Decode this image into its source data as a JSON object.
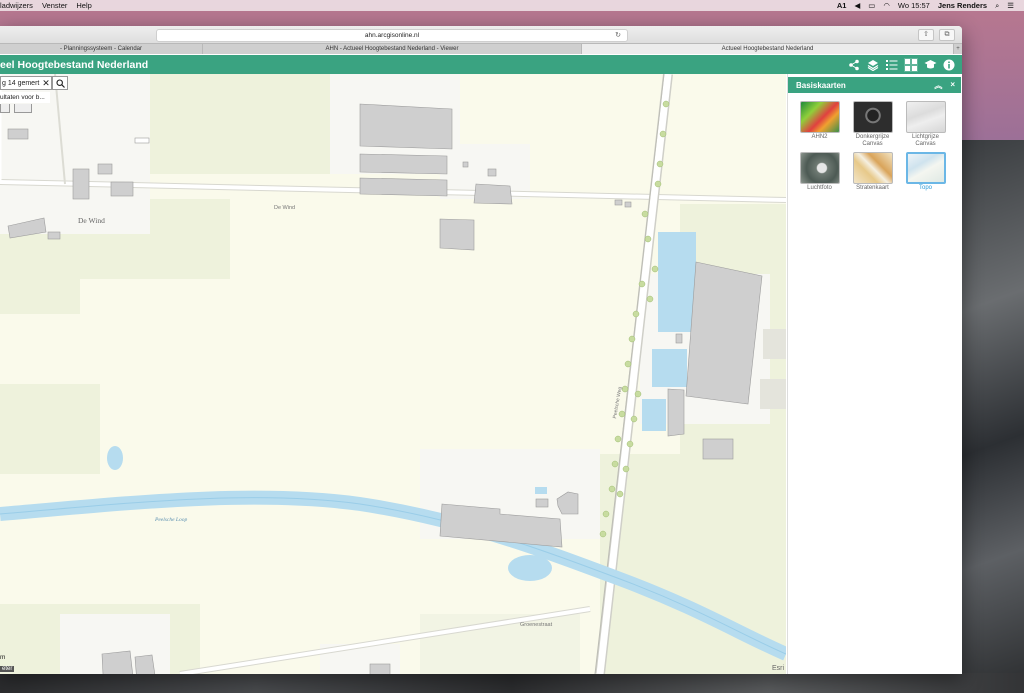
{
  "menubar": {
    "left_items": [
      "ladwijzers",
      "Venster",
      "Help"
    ],
    "status_input": "1",
    "clock": "Wo 15:57",
    "user": "Jens Renders"
  },
  "browser": {
    "address": "ahn.arcgisonline.nl",
    "tabs": [
      {
        "label": "- Planningssysteem - Calendar",
        "active": false
      },
      {
        "label": "AHN - Actueel Hoogtebestand Nederland - Viewer",
        "active": false
      },
      {
        "label": "Actueel Hoogtebestand Nederland",
        "active": true
      }
    ],
    "new_tab": "+"
  },
  "app": {
    "title": "eel Hoogtebestand Nederland",
    "tools": [
      "share-icon",
      "layers-icon",
      "legend-icon",
      "basemap-gallery-icon",
      "education-icon",
      "info-icon"
    ],
    "accent_color": "#3aa381"
  },
  "search": {
    "value": "g 14 gemert",
    "results_text": "ultaten voor b..."
  },
  "map": {
    "labels": {
      "de_wind_place": "De Wind",
      "de_wind_road": "De Wind",
      "river": "Peelsche Loop",
      "road_south": "Groenestraat",
      "road_vertical": "Peelsche Weg"
    },
    "attribution_left": "eter",
    "attribution_m": "m",
    "attribution_right": "Esri"
  },
  "panel": {
    "title": "Basiskaarten",
    "collapse": "«",
    "close": "×",
    "basemaps": [
      {
        "label": "AHN2",
        "selected": false
      },
      {
        "label": "Donkergrijze Canvas",
        "selected": false
      },
      {
        "label": "Lichtgrijze Canvas",
        "selected": false
      },
      {
        "label": "Luchtfoto",
        "selected": false
      },
      {
        "label": "Stratenkaart",
        "selected": false
      },
      {
        "label": "Topo",
        "selected": true
      }
    ]
  }
}
